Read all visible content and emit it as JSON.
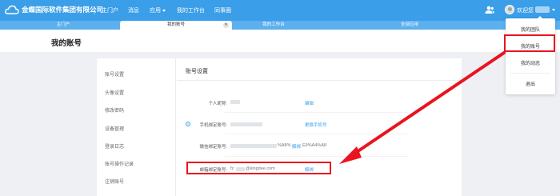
{
  "header": {
    "brand": "金蝶国际软件集团有限公司",
    "nav": [
      {
        "label": "主门户"
      },
      {
        "label": "消息"
      },
      {
        "label": "应用"
      },
      {
        "label": "我的工作台"
      },
      {
        "label": "同事圈"
      }
    ],
    "welcome": "欢迎您"
  },
  "tabs": [
    {
      "label": "主门户",
      "active": false
    },
    {
      "label": "我的账号",
      "active": true
    },
    {
      "label": "我的工作台",
      "active": false
    },
    {
      "label": "全部应用",
      "active": false
    }
  ],
  "tab_close_glyph": "✕",
  "page": {
    "title": "我的账号"
  },
  "left_menu": [
    "账号设置",
    "头像设置",
    "修改密码",
    "设备管理",
    "登录日志",
    "账号操作记录",
    "注销账号"
  ],
  "content": {
    "title": "账号设置",
    "fields": {
      "nickname": {
        "label": "个人昵称:",
        "action": "编辑"
      },
      "phone": {
        "label": "手机绑定账号:",
        "action": "更换手机号"
      },
      "wechat": {
        "label": "微信绑定账号:",
        "value": "%A8%",
        "action": "解绑",
        "value_tail": "E9%A4%A8"
      },
      "email": {
        "label": "邮箱绑定账号:",
        "value_prefix": "fz",
        "value_domain": "@kingdee.com",
        "action": "解绑"
      }
    }
  },
  "dropdown": {
    "items": [
      "我的团队",
      "我的账号",
      "我的动态",
      "退出"
    ]
  },
  "colors": {
    "topbar": "#3a9ee8",
    "highlight": "#e8141f",
    "link": "#3a9ee8"
  },
  "icons": [
    "cloud-logo-icon",
    "caret-down-icon",
    "users-icon",
    "avatar",
    "close-icon",
    "info-icon",
    "arrow"
  ]
}
